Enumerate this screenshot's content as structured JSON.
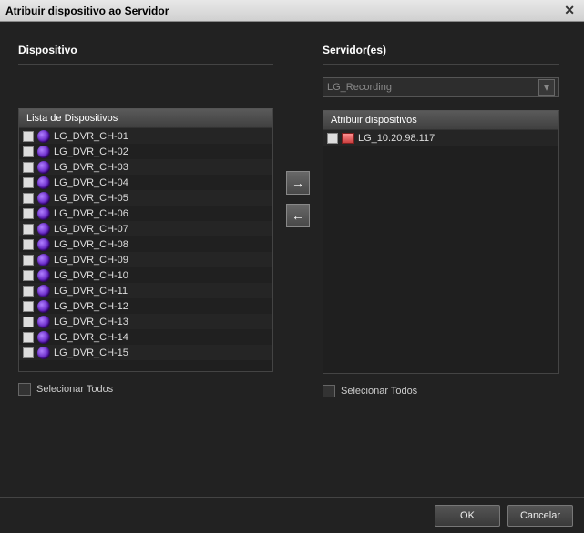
{
  "window": {
    "title": "Atribuir dispositivo ao Servidor"
  },
  "leftPanel": {
    "title": "Dispositivo",
    "listHeader": "Lista de Dispositivos",
    "selectAll": "Selecionar Todos",
    "items": [
      {
        "label": "LG_DVR_CH-01"
      },
      {
        "label": "LG_DVR_CH-02"
      },
      {
        "label": "LG_DVR_CH-03"
      },
      {
        "label": "LG_DVR_CH-04"
      },
      {
        "label": "LG_DVR_CH-05"
      },
      {
        "label": "LG_DVR_CH-06"
      },
      {
        "label": "LG_DVR_CH-07"
      },
      {
        "label": "LG_DVR_CH-08"
      },
      {
        "label": "LG_DVR_CH-09"
      },
      {
        "label": "LG_DVR_CH-10"
      },
      {
        "label": "LG_DVR_CH-11"
      },
      {
        "label": "LG_DVR_CH-12"
      },
      {
        "label": "LG_DVR_CH-13"
      },
      {
        "label": "LG_DVR_CH-14"
      },
      {
        "label": "LG_DVR_CH-15"
      }
    ]
  },
  "rightPanel": {
    "title": "Servidor(es)",
    "dropdown": "LG_Recording",
    "listHeader": "Atribuir dispositivos",
    "selectAll": "Selecionar Todos",
    "items": [
      {
        "label": "LG_10.20.98.117"
      }
    ]
  },
  "buttons": {
    "ok": "OK",
    "cancel": "Cancelar"
  }
}
